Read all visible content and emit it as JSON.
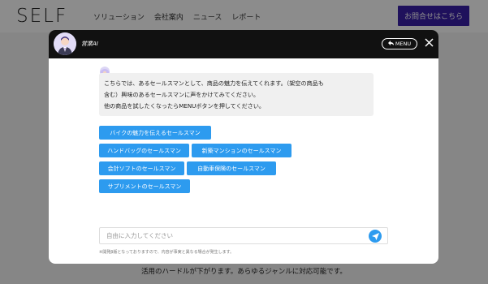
{
  "site": {
    "logo": "SELF",
    "nav": [
      "ソリューション",
      "会社案内",
      "ニュース",
      "レポート"
    ],
    "contact_button": "お問合せはこちら",
    "footer_text": "活用のハードルが下がります。あらゆるジャンルに対応可能です。"
  },
  "chat": {
    "bot_name": "営業AI",
    "menu_button": "MENU",
    "message_lines": [
      "こちらでは、あるセールスマンとして、商品の魅力を伝えてくれます。（架空の商品も",
      "含む）興味のあるセールスマンに声をかけてみてください。",
      "他の商品を試したくなったらMENUボタンを押してください。"
    ],
    "choices": [
      "バイクの魅力を伝えるセールスマン",
      "ハンドバッグのセールスマン",
      "新築マンションのセールスマン",
      "会計ソフトのセールスマン",
      "自動車保険のセールスマン",
      "サプリメントのセールスマン"
    ],
    "input_placeholder": "自由に入力してください",
    "disclaimer": "※開発β版となっておりますので、内容が事実と異なる場合が発生します。"
  },
  "colors": {
    "accent": "#2d9bef",
    "brand": "#3a1fa8",
    "header": "#111111"
  }
}
